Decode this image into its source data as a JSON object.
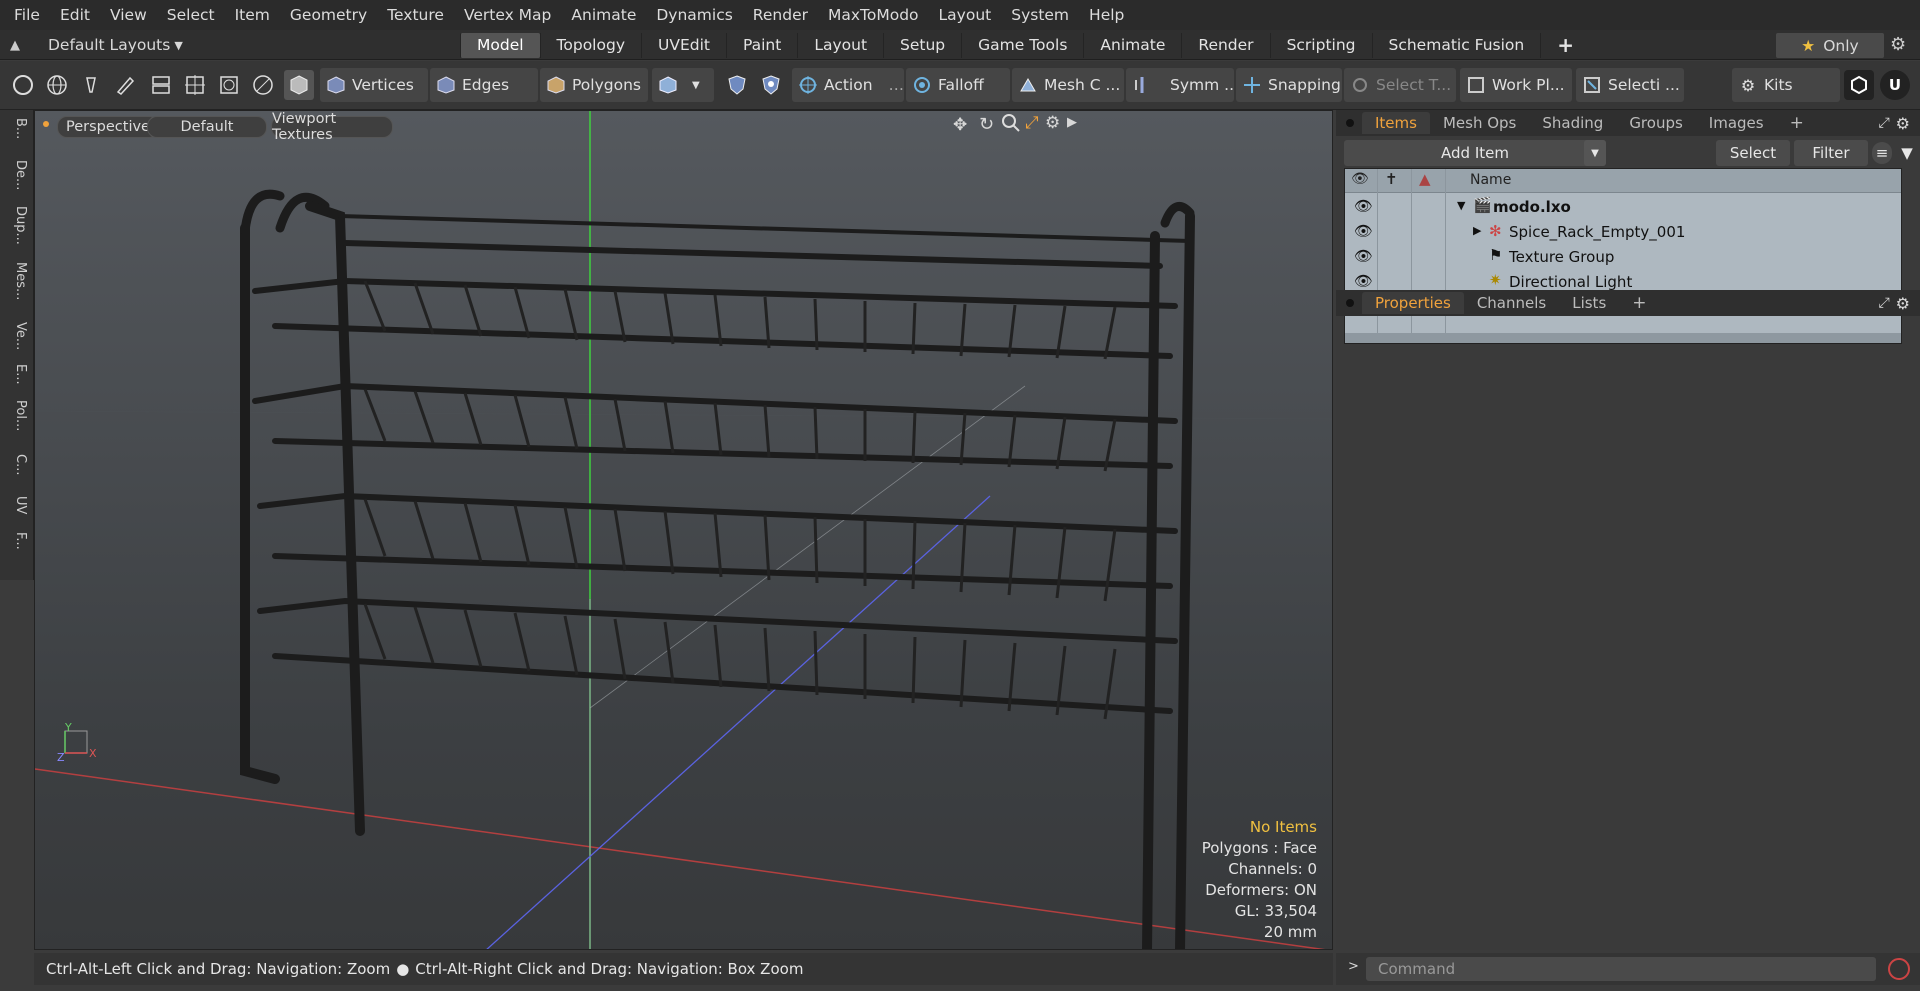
{
  "menu": [
    "File",
    "Edit",
    "View",
    "Select",
    "Item",
    "Geometry",
    "Texture",
    "Vertex Map",
    "Animate",
    "Dynamics",
    "Render",
    "MaxToModo",
    "Layout",
    "System",
    "Help"
  ],
  "layout_selector": "Default Layouts",
  "tabs": [
    "Model",
    "Topology",
    "UVEdit",
    "Paint",
    "Layout",
    "Setup",
    "Game Tools",
    "Animate",
    "Render",
    "Scripting",
    "Schematic Fusion"
  ],
  "active_tab": "Model",
  "only_label": "Only",
  "toolbar": {
    "vertices": "Vertices",
    "edges": "Edges",
    "polygons": "Polygons",
    "action": "Action",
    "falloff": "Falloff",
    "mesh_c": "Mesh C ...",
    "symm": "Symm ...",
    "snapping": "Snapping",
    "select_t": "Select T...",
    "work_pl": "Work Pl...",
    "selecti": "Selecti ...",
    "kits": "Kits"
  },
  "left_tabs": [
    "B...",
    "De...",
    "Dup...",
    "Mes...",
    "Ve...",
    "E...",
    "Pol...",
    "C...",
    "UV",
    "F..."
  ],
  "viewport": {
    "view_mode": "Perspective",
    "shading": "Default",
    "textures": "Viewport Textures",
    "stats": {
      "items": "No Items",
      "polygons": "Polygons : Face",
      "channels": "Channels: 0",
      "deformers": "Deformers: ON",
      "gl": "GL: 33,504",
      "scale": "20 mm"
    },
    "axis_y": "Y",
    "axis_x": "X",
    "axis_z": "Z"
  },
  "items_panel": {
    "tabs": [
      "Items",
      "Mesh Ops",
      "Shading",
      "Groups",
      "Images"
    ],
    "active_tab": "Items",
    "add_item": "Add Item",
    "select": "Select",
    "filter": "Filter",
    "name_header": "Name",
    "rows": [
      {
        "label": "modo.lxo"
      },
      {
        "label": "Spice_Rack_Empty_001"
      },
      {
        "label": "Texture Group"
      },
      {
        "label": "Directional Light"
      }
    ]
  },
  "properties_panel": {
    "tabs": [
      "Properties",
      "Channels",
      "Lists"
    ],
    "active_tab": "Properties"
  },
  "status_bar": {
    "hint_left": "Ctrl-Alt-Left Click and Drag: Navigation: Zoom",
    "hint_right": "Ctrl-Alt-Right Click and Drag: Navigation: Box Zoom"
  },
  "command": {
    "placeholder": "Command"
  },
  "colors": {
    "accent_orange": "#f0a23c",
    "grid_red": "#c94040",
    "grid_green": "#3fd03f",
    "grid_blue": "#5a62e0"
  }
}
